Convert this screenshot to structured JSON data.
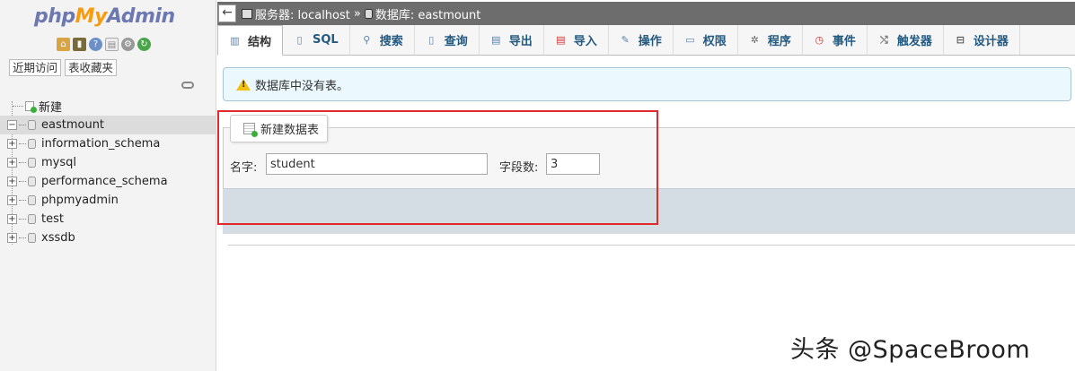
{
  "sidebar": {
    "logo": {
      "php": "php",
      "my": "My",
      "admin": "Admin"
    },
    "quick_icons": [
      "home-icon",
      "logout-icon",
      "help-icon",
      "docs-icon",
      "settings-icon",
      "reload-icon"
    ],
    "tabs": [
      "近期访问",
      "表收藏夹"
    ],
    "tree": [
      {
        "label": "新建",
        "type": "new"
      },
      {
        "label": "eastmount",
        "type": "db",
        "selected": true
      },
      {
        "label": "information_schema",
        "type": "db"
      },
      {
        "label": "mysql",
        "type": "db"
      },
      {
        "label": "performance_schema",
        "type": "db"
      },
      {
        "label": "phpmyadmin",
        "type": "db"
      },
      {
        "label": "test",
        "type": "db"
      },
      {
        "label": "xssdb",
        "type": "db"
      }
    ]
  },
  "breadcrumb": {
    "back": "←",
    "server_label": "服务器: localhost",
    "separator": "»",
    "database_label": "数据库: eastmount"
  },
  "tabs": [
    {
      "label": "结构",
      "icon": "structure-icon",
      "active": true
    },
    {
      "label": "SQL",
      "icon": "sql-icon"
    },
    {
      "label": "搜索",
      "icon": "search-icon"
    },
    {
      "label": "查询",
      "icon": "query-icon"
    },
    {
      "label": "导出",
      "icon": "export-icon"
    },
    {
      "label": "导入",
      "icon": "import-icon"
    },
    {
      "label": "操作",
      "icon": "wrench-icon"
    },
    {
      "label": "权限",
      "icon": "privileges-icon"
    },
    {
      "label": "程序",
      "icon": "routines-icon"
    },
    {
      "label": "事件",
      "icon": "events-icon"
    },
    {
      "label": "触发器",
      "icon": "triggers-icon"
    },
    {
      "label": "设计器",
      "icon": "designer-icon"
    }
  ],
  "notice": {
    "text": "数据库中没有表。"
  },
  "create_table": {
    "legend": "新建数据表",
    "name_label": "名字:",
    "name_value": "student",
    "fields_label": "字段数:",
    "fields_value": "3"
  },
  "watermark": "头条 @SpaceBroom",
  "colors": {
    "highlight": "#e12a2a",
    "tab_link": "#235a81",
    "notice_bg": "#ebf8fd"
  }
}
